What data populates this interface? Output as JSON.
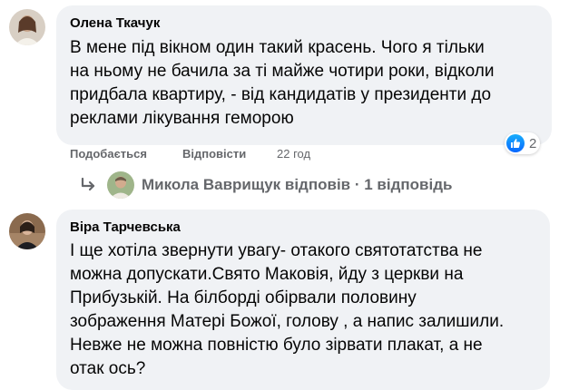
{
  "comments": [
    {
      "author": "Олена Ткачук",
      "lines": [
        "В мене під вікном один такий красень. Чого я тільки",
        "на ньому не бачила за ті майже чотири роки, відколи",
        "придбала квартиру, - від кандидатів у президенти до",
        "реклами лікування геморою"
      ],
      "actions": {
        "like": "Подобається",
        "reply": "Відповісти",
        "time": "22 год"
      },
      "reactions": {
        "icon": "like-icon",
        "count": "2"
      },
      "replies_summary": "Микола Ваврищук відповів · 1 відповідь"
    },
    {
      "author": "Віра Тарчевська",
      "lines": [
        "І ще хотіла звернути увагу- отакого святотатства не",
        "можна допускати.Свято Маковія, йду з церкви на",
        "Прибузькій. На білборді обірвали половину",
        "зображення Матері Божої, голову , а напис залишили.",
        "Невже не можна повністю було зірвати плакат, а не",
        "отак ось?"
      ]
    }
  ],
  "colors": {
    "bubble": "#f0f2f5",
    "secondary_text": "#65676b",
    "like_blue": "#0866ff"
  }
}
